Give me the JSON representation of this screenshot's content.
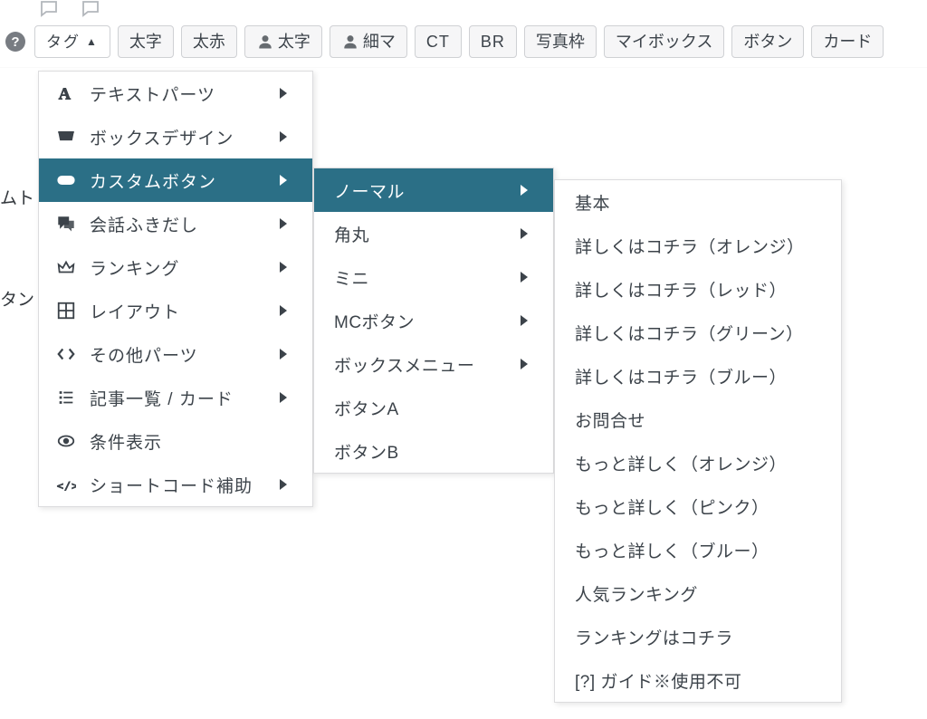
{
  "colors": {
    "accent": "#2b6f86",
    "border": "#cfd1d4",
    "text": "#3c434a"
  },
  "toolbar": {
    "tag_label": "タグ",
    "buttons": [
      {
        "key": "bold",
        "label": "太字"
      },
      {
        "key": "bold_red",
        "label": "太赤"
      },
      {
        "key": "person_bold",
        "label": "太字",
        "icon": "person"
      },
      {
        "key": "person_thin",
        "label": "細マ",
        "icon": "person"
      },
      {
        "key": "ct",
        "label": "CT"
      },
      {
        "key": "br",
        "label": "BR"
      },
      {
        "key": "photo_frame",
        "label": "写真枠"
      },
      {
        "key": "mybox",
        "label": "マイボックス"
      },
      {
        "key": "button",
        "label": "ボタン"
      },
      {
        "key": "card",
        "label": "カード"
      }
    ]
  },
  "bg_text": {
    "line1": "ムト",
    "line2": "タン"
  },
  "menu1": {
    "items": [
      {
        "icon": "font-a",
        "label": "テキストパーツ",
        "sub": true
      },
      {
        "icon": "inbox",
        "label": "ボックスデザイン",
        "sub": true
      },
      {
        "icon": "toggle",
        "label": "カスタムボタン",
        "sub": true,
        "active": true
      },
      {
        "icon": "speech",
        "label": "会話ふきだし",
        "sub": true
      },
      {
        "icon": "crown",
        "label": "ランキング",
        "sub": true
      },
      {
        "icon": "grid",
        "label": "レイアウト",
        "sub": true
      },
      {
        "icon": "code",
        "label": "その他パーツ",
        "sub": true
      },
      {
        "icon": "list",
        "label": "記事一覧 / カード",
        "sub": true
      },
      {
        "icon": "eye",
        "label": "条件表示",
        "sub": false
      },
      {
        "icon": "codetag",
        "label": "ショートコード補助",
        "sub": true
      }
    ]
  },
  "menu2": {
    "items": [
      {
        "label": "ノーマル",
        "sub": true,
        "active": true
      },
      {
        "label": "角丸",
        "sub": true
      },
      {
        "label": "ミニ",
        "sub": true
      },
      {
        "label": "MCボタン",
        "sub": true
      },
      {
        "label": "ボックスメニュー",
        "sub": true
      },
      {
        "label": "ボタンA",
        "sub": false
      },
      {
        "label": "ボタンB",
        "sub": false
      }
    ]
  },
  "menu3": {
    "items": [
      {
        "label": "基本"
      },
      {
        "label": "詳しくはコチラ（オレンジ）"
      },
      {
        "label": "詳しくはコチラ（レッド）"
      },
      {
        "label": "詳しくはコチラ（グリーン）"
      },
      {
        "label": "詳しくはコチラ（ブルー）"
      },
      {
        "label": "お問合せ"
      },
      {
        "label": "もっと詳しく（オレンジ）"
      },
      {
        "label": "もっと詳しく（ピンク）"
      },
      {
        "label": "もっと詳しく（ブルー）"
      },
      {
        "label": "人気ランキング"
      },
      {
        "label": "ランキングはコチラ"
      },
      {
        "label": "[?] ガイド※使用不可"
      }
    ]
  }
}
